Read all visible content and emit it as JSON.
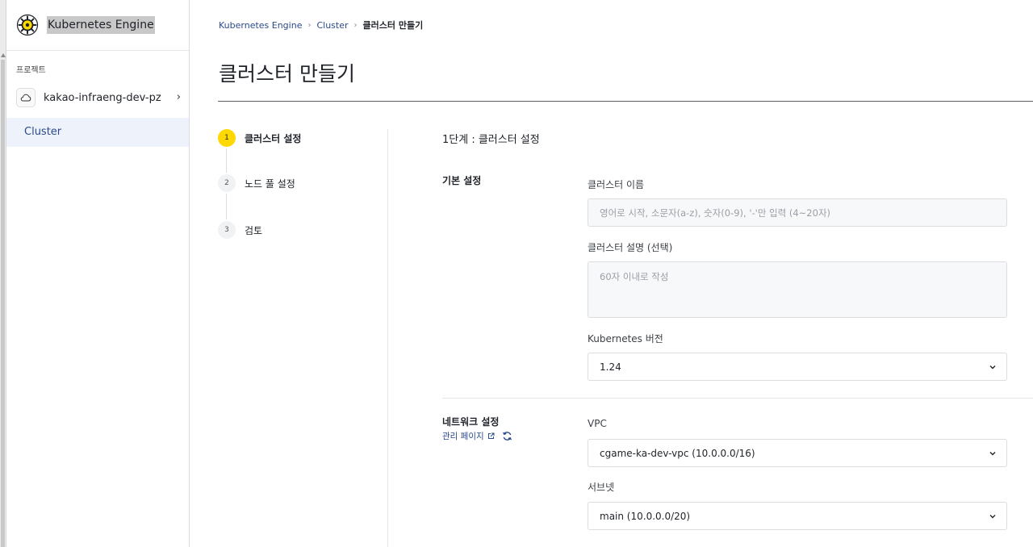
{
  "sidebar": {
    "brand_name": "Kubernetes Engine",
    "project_label": "프로젝트",
    "project_name": "kakao-infraeng-dev-pz",
    "project_chevron": "›",
    "nav_items": [
      {
        "label": "Cluster",
        "selected": true
      }
    ]
  },
  "breadcrumb": {
    "items": [
      "Kubernetes Engine",
      "Cluster"
    ],
    "current": "클러스터 만들기",
    "separator": "›"
  },
  "page_title": "클러스터 만들기",
  "stepper": {
    "steps": [
      {
        "number": "1",
        "label": "클러스터 설정",
        "active": true
      },
      {
        "number": "2",
        "label": "노드 풀 설정",
        "active": false
      },
      {
        "number": "3",
        "label": "검토",
        "active": false
      }
    ]
  },
  "form": {
    "step_title": "1단계 : 클러스터 설정",
    "basic": {
      "title": "기본 설정",
      "cluster_name_label": "클러스터 이름",
      "cluster_name_placeholder": "영어로 시작, 소문자(a-z), 숫자(0-9), '-'만 입력 (4~20자)",
      "cluster_desc_label": "클러스터 설명 (선택)",
      "cluster_desc_placeholder": "60자 이내로 작성",
      "version_label": "Kubernetes 버전",
      "version_value": "1.24"
    },
    "network": {
      "title": "네트워크 설정",
      "manage_link": "관리 페이지",
      "vpc_label": "VPC",
      "vpc_value": "cgame-ka-dev-vpc (10.0.0.0/16)",
      "subnet_label": "서브넷",
      "subnet_value": "main (10.0.0.0/20)"
    }
  },
  "colors": {
    "accent_yellow": "#ffd800",
    "link_blue": "#2b4a8b",
    "selected_bg": "#eef3fb"
  },
  "icons": [
    "kubernetes-logo-icon",
    "cloud-icon",
    "chevron-right-icon",
    "chevron-down-icon",
    "external-link-icon",
    "refresh-icon"
  ]
}
